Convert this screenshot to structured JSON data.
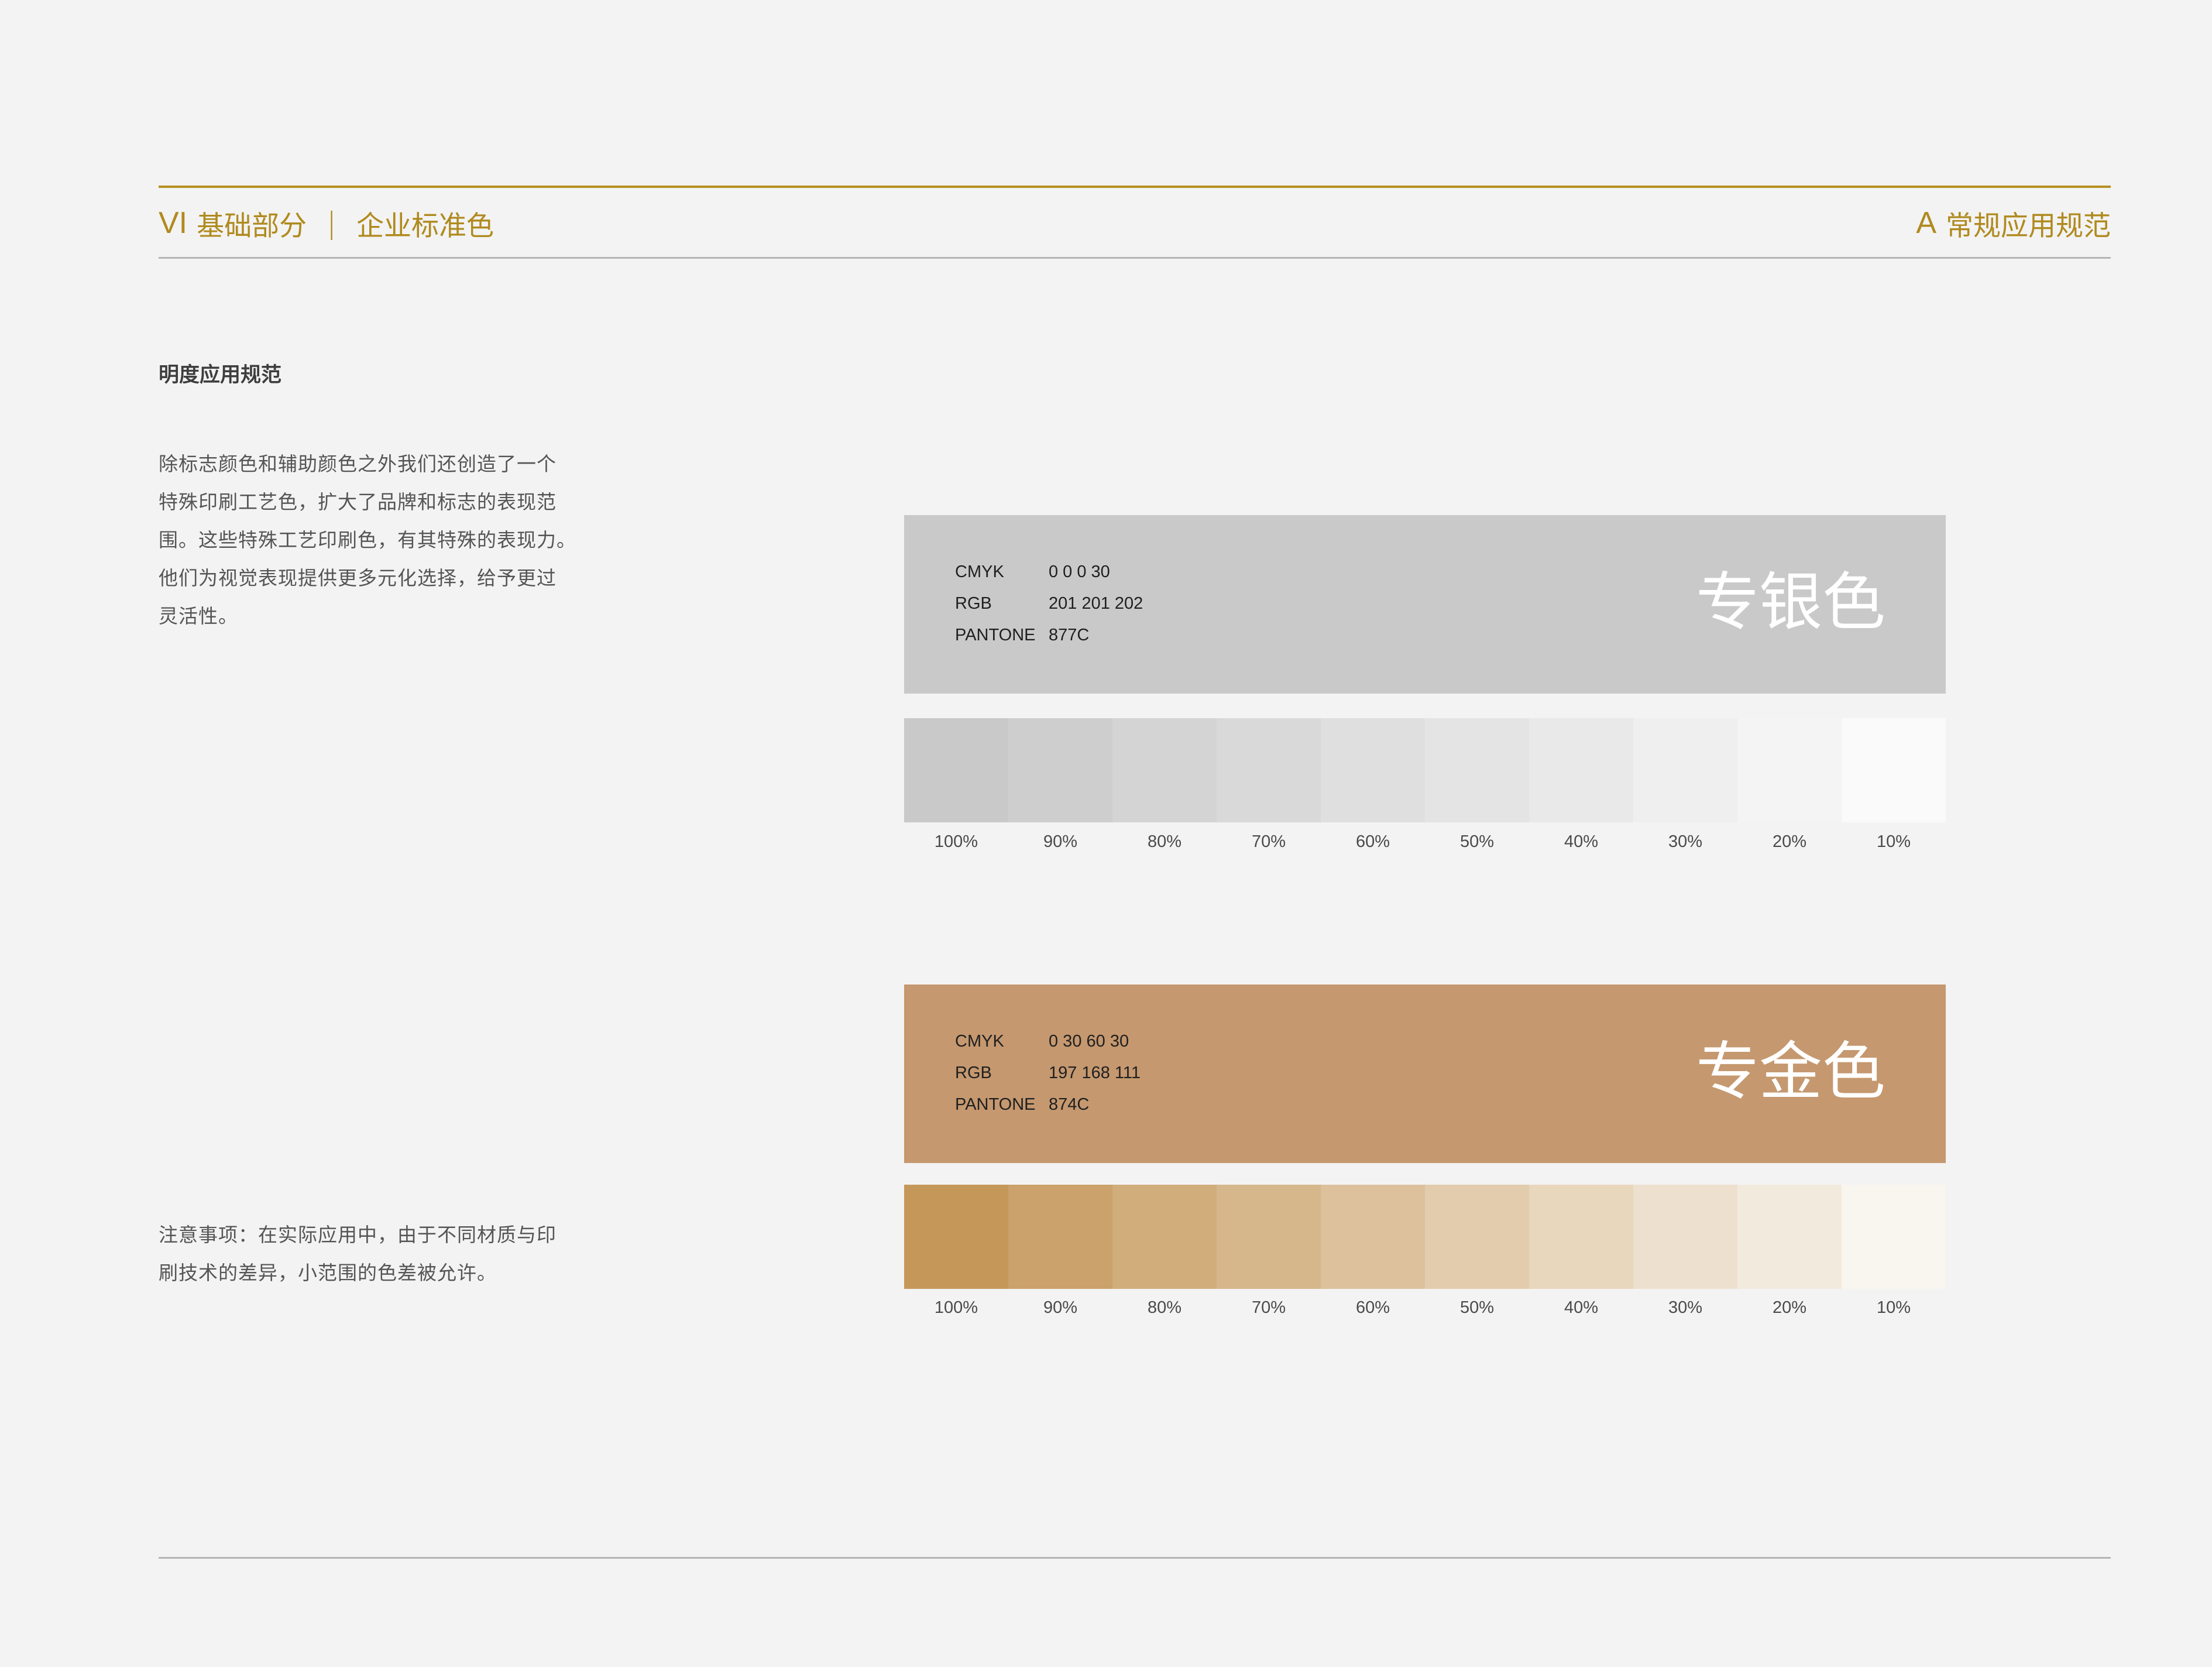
{
  "header": {
    "left_code": "VI",
    "left_section": "基础部分",
    "left_separator": "|",
    "left_title": "企业标准色",
    "right_code": "A",
    "right_title": "常规应用规范"
  },
  "section": {
    "title": "明度应用规范",
    "body_lines": [
      "除标志颜色和辅助颜色之外我们还创造了一个",
      "特殊印刷工艺色，扩大了品牌和标志的表现范",
      "围。这些特殊工艺印刷色，有其特殊的表现力。",
      "他们为视觉表现提供更多元化选择，给予更过",
      "灵活性。"
    ],
    "note_lines": [
      "注意事项：在实际应用中，由于不同材质与印",
      "刷技术的差异，小范围的色差被允许。"
    ]
  },
  "colors": [
    {
      "name": "专银色",
      "color": "#c9c9ca",
      "specs": [
        {
          "label": "CMYK",
          "value": "0  0  0  30"
        },
        {
          "label": "RGB",
          "value": "201  201  202"
        },
        {
          "label": "PANTONE",
          "value": "877C"
        }
      ],
      "tint_color_rgb": [
        201,
        201,
        202
      ],
      "tints": [
        {
          "label": "100%",
          "percent": 100
        },
        {
          "label": "90%",
          "percent": 90
        },
        {
          "label": "80%",
          "percent": 80
        },
        {
          "label": "70%",
          "percent": 70
        },
        {
          "label": "60%",
          "percent": 60
        },
        {
          "label": "50%",
          "percent": 50
        },
        {
          "label": "40%",
          "percent": 40
        },
        {
          "label": "30%",
          "percent": 30
        },
        {
          "label": "20%",
          "percent": 20
        },
        {
          "label": "10%",
          "percent": 10
        }
      ]
    },
    {
      "name": "专金色",
      "color": "#c5986f",
      "specs": [
        {
          "label": "CMYK",
          "value": "0  30  60  30"
        },
        {
          "label": "RGB",
          "value": "197  168  111"
        },
        {
          "label": "PANTONE",
          "value": "874C"
        }
      ],
      "tint_color_rgb": [
        197,
        152,
        90
      ],
      "tints": [
        {
          "label": "100%",
          "percent": 100
        },
        {
          "label": "90%",
          "percent": 90
        },
        {
          "label": "80%",
          "percent": 80
        },
        {
          "label": "70%",
          "percent": 70
        },
        {
          "label": "60%",
          "percent": 60
        },
        {
          "label": "50%",
          "percent": 50
        },
        {
          "label": "40%",
          "percent": 40
        },
        {
          "label": "30%",
          "percent": 30
        },
        {
          "label": "20%",
          "percent": 20
        },
        {
          "label": "10%",
          "percent": 10
        }
      ]
    }
  ],
  "theme": {
    "background": "#f3f3f3",
    "accent": "#b08a1e",
    "rule_gray": "#b5b5b5"
  }
}
